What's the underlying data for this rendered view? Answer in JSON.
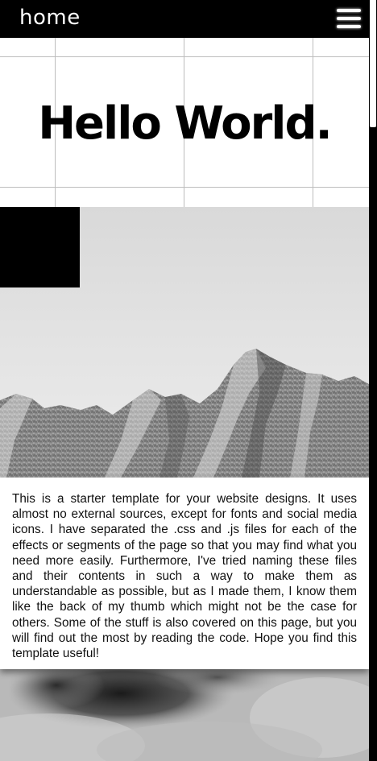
{
  "nav": {
    "home_label": "home",
    "menu_icon": "hamburger-menu-icon"
  },
  "hero": {
    "title": "Hello World."
  },
  "intro": {
    "text": "This is a starter template for your website designs. It uses almost no external sources, except for fonts and social media icons. I have separated the .css and .js files for each of the effects or segments of the page so that you may find what you need more easily. Furthermore, I've tried naming these files and their contents in such a way to make them as understandable as possible, but as I made them, I know them like the back of my thumb which might not be the case for others. Some of the stuff is also covered on this page, but you will find out the most by reading the code. Hope you find this template useful!"
  },
  "colors": {
    "nav_background": "#000000",
    "nav_text": "#ffffff",
    "hero_grid_lines": "#bdbdbd",
    "body_text": "#111111"
  }
}
